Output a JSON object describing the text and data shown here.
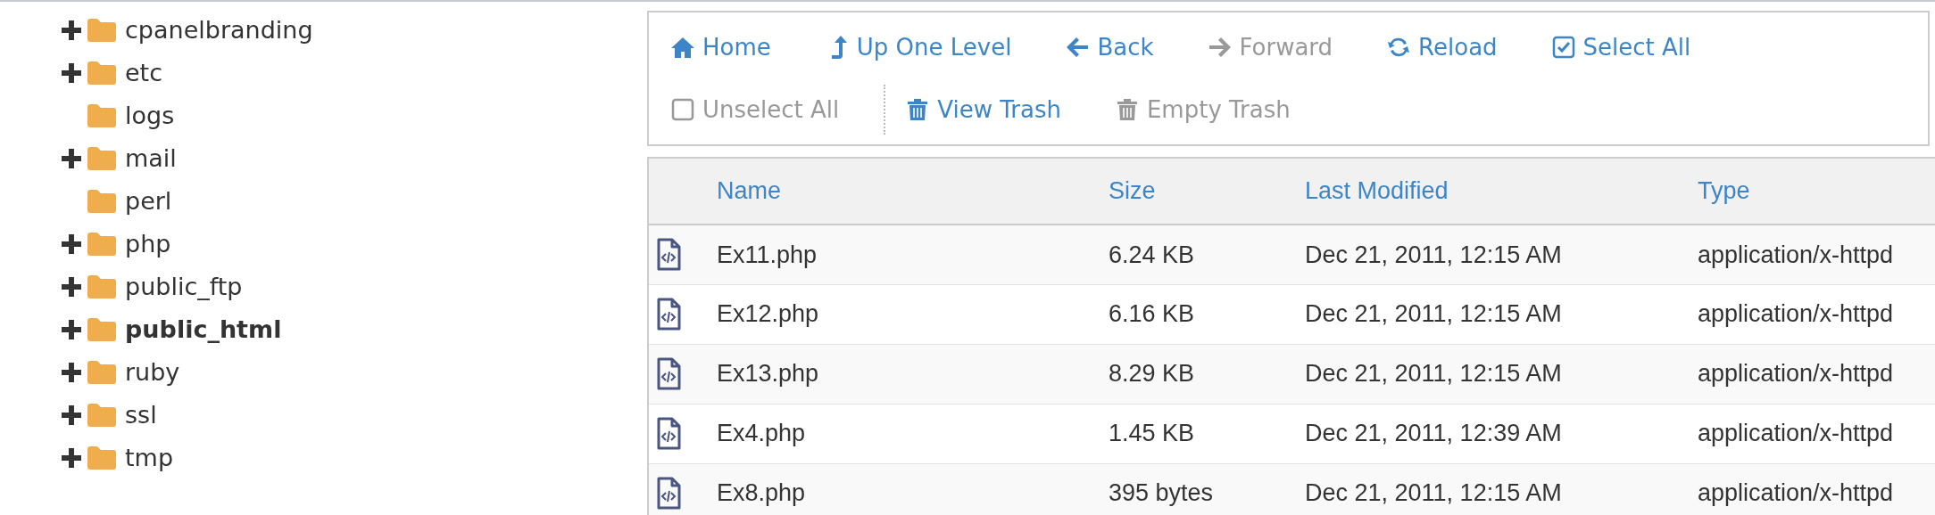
{
  "tree": [
    {
      "label": "cpanelbranding",
      "expandable": true,
      "selected": false
    },
    {
      "label": "etc",
      "expandable": true,
      "selected": false
    },
    {
      "label": "logs",
      "expandable": false,
      "selected": false
    },
    {
      "label": "mail",
      "expandable": true,
      "selected": false
    },
    {
      "label": "perl",
      "expandable": false,
      "selected": false
    },
    {
      "label": "php",
      "expandable": true,
      "selected": false
    },
    {
      "label": "public_ftp",
      "expandable": true,
      "selected": false
    },
    {
      "label": "public_html",
      "expandable": true,
      "selected": true
    },
    {
      "label": "ruby",
      "expandable": true,
      "selected": false
    },
    {
      "label": "ssl",
      "expandable": true,
      "selected": false
    },
    {
      "label": "tmp",
      "expandable": true,
      "selected": false
    }
  ],
  "toolbar": [
    [
      {
        "label": "Home",
        "kind": "home",
        "disabled": false
      },
      {
        "label": "Up One Level",
        "kind": "up",
        "disabled": false
      },
      {
        "label": "Back",
        "kind": "back",
        "disabled": false
      },
      {
        "label": "Forward",
        "kind": "forward",
        "disabled": true
      },
      {
        "label": "Reload",
        "kind": "reload",
        "disabled": false
      },
      {
        "label": "Select All",
        "kind": "check",
        "disabled": false
      }
    ],
    [
      {
        "label": "Unselect All",
        "kind": "uncheck",
        "disabled": true
      },
      {
        "label": "View Trash",
        "kind": "trash",
        "disabled": false
      },
      {
        "label": "Empty Trash",
        "kind": "trash",
        "disabled": true
      }
    ]
  ],
  "table": {
    "columns": [
      "Name",
      "Size",
      "Last Modified",
      "Type"
    ],
    "rows": [
      {
        "name": "Ex11.php",
        "size": "6.24 KB",
        "modified": "Dec 21, 2011, 12:15 AM",
        "type": "application/x-httpd"
      },
      {
        "name": "Ex12.php",
        "size": "6.16 KB",
        "modified": "Dec 21, 2011, 12:15 AM",
        "type": "application/x-httpd"
      },
      {
        "name": "Ex13.php",
        "size": "8.29 KB",
        "modified": "Dec 21, 2011, 12:15 AM",
        "type": "application/x-httpd"
      },
      {
        "name": "Ex4.php",
        "size": "1.45 KB",
        "modified": "Dec 21, 2011, 12:39 AM",
        "type": "application/x-httpd"
      },
      {
        "name": "Ex8.php",
        "size": "395 bytes",
        "modified": "Dec 21, 2011, 12:15 AM",
        "type": "application/x-httpd"
      }
    ]
  }
}
